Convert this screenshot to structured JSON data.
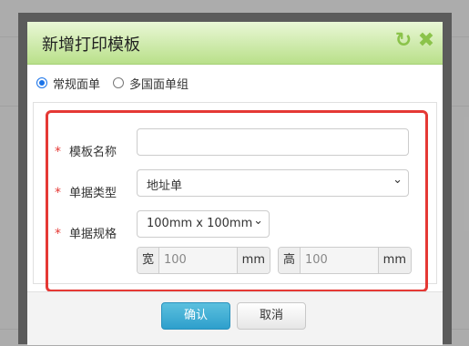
{
  "dialog": {
    "title": "新增打印模板",
    "refresh_icon": "refresh-icon",
    "close_icon": "close-icon"
  },
  "mode": {
    "options": [
      {
        "label": "常规面单",
        "selected": true
      },
      {
        "label": "多国面单组",
        "selected": false
      }
    ]
  },
  "form": {
    "required_mark": "*",
    "template_name": {
      "label": "模板名称",
      "value": ""
    },
    "doc_type": {
      "label": "单据类型",
      "value": "地址单"
    },
    "doc_size": {
      "label": "单据规格",
      "value": "100mm x 100mm",
      "width": {
        "prefix": "宽",
        "value": "100",
        "unit": "mm"
      },
      "height": {
        "prefix": "高",
        "value": "100",
        "unit": "mm"
      }
    }
  },
  "buttons": {
    "confirm": "确认",
    "cancel": "取消"
  },
  "colors": {
    "titlebar": "#b9e08a",
    "highlight": "#e53935",
    "primary": "#2e9fcc",
    "required": "#e53935"
  }
}
